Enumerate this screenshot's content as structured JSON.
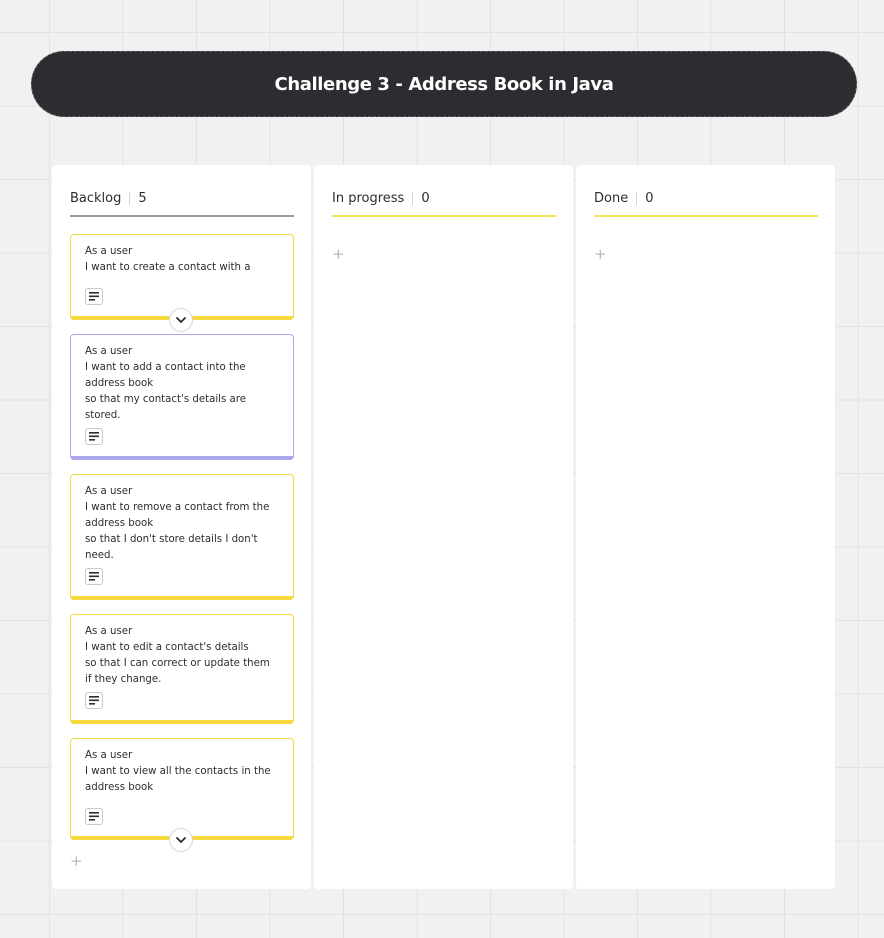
{
  "board": {
    "title": "Challenge 3 - Address Book in Java"
  },
  "columns": [
    {
      "name": "Backlog",
      "count": "5",
      "add_label": "+",
      "cards": [
        {
          "lines": [
            "As a user",
            "I want to create a contact with a"
          ],
          "color": "#f5d93f",
          "truncated": true
        },
        {
          "lines": [
            "As a user",
            "I want to add a contact into the",
            "address book",
            "so that my contact's details are",
            "stored."
          ],
          "color": "#aaa7ec"
        },
        {
          "lines": [
            "As a user",
            "I want to remove a contact from the",
            "address book",
            "so that I don't store details I don't",
            "need."
          ],
          "color": "#f5d93f"
        },
        {
          "lines": [
            "As a user",
            "I want to edit a contact's details",
            "so that I can correct or update them",
            "if they change."
          ],
          "color": "#f5d93f"
        },
        {
          "lines": [
            "As a user",
            "I want to view all the contacts in the",
            "address book"
          ],
          "color": "#f5d93f",
          "truncated": true
        }
      ]
    },
    {
      "name": "In progress",
      "count": "0",
      "add_label": "+"
    },
    {
      "name": "Done",
      "count": "0",
      "add_label": "+"
    }
  ],
  "icons": {
    "note": "note-icon",
    "expand": "chevron-down-icon",
    "add": "plus-icon"
  },
  "colors": {
    "title_bg": "#2b2d31",
    "card_yellow": "#f5d93f",
    "card_purple": "#aaa7ec"
  }
}
